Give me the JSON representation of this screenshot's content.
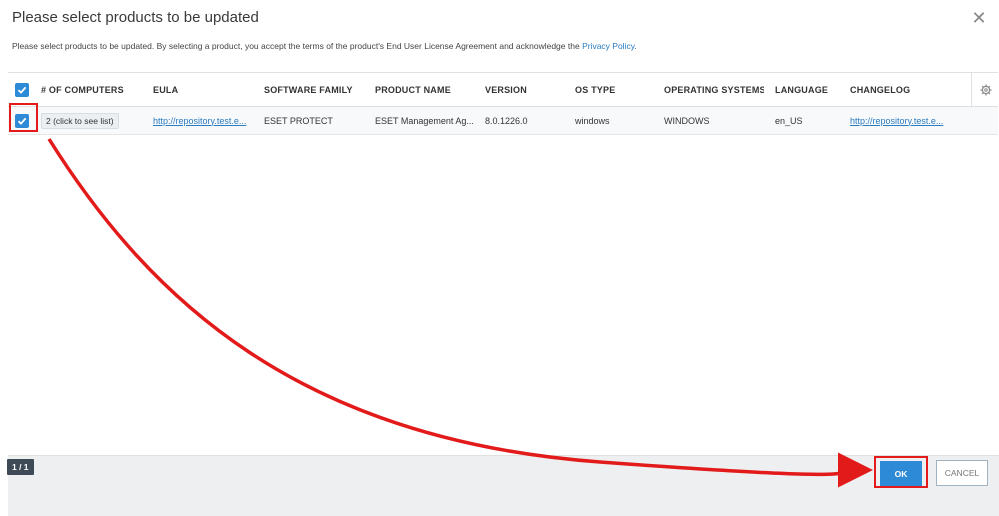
{
  "dialog": {
    "title": "Please select products to be updated",
    "subtitle_prefix": "Please select products to be updated. By selecting a product, you accept the terms of the product's End User License Agreement and acknowledge the ",
    "privacy_link": "Privacy Policy",
    "subtitle_suffix": "."
  },
  "table": {
    "headers": {
      "computers": "# OF COMPUTERS",
      "eula": "EULA",
      "family": "SOFTWARE FAMILY",
      "product": "PRODUCT NAME",
      "version": "VERSION",
      "ostype": "OS TYPE",
      "os": "OPERATING SYSTEMS",
      "language": "LANGUAGE",
      "changelog": "CHANGELOG"
    },
    "rows": [
      {
        "computers": "2 (click to see list)",
        "eula": "http://repository.test.e...",
        "family": "ESET PROTECT",
        "product": "ESET Management Ag...",
        "version": "8.0.1226.0",
        "ostype": "windows",
        "os": "WINDOWS",
        "language": "en_US",
        "changelog": "http://repository.test.e..."
      }
    ]
  },
  "pager": {
    "label": "1 / 1"
  },
  "buttons": {
    "ok": "OK",
    "cancel": "CANCEL"
  },
  "colors": {
    "accent": "#2d8ad6",
    "highlight": "#e21a1a"
  }
}
